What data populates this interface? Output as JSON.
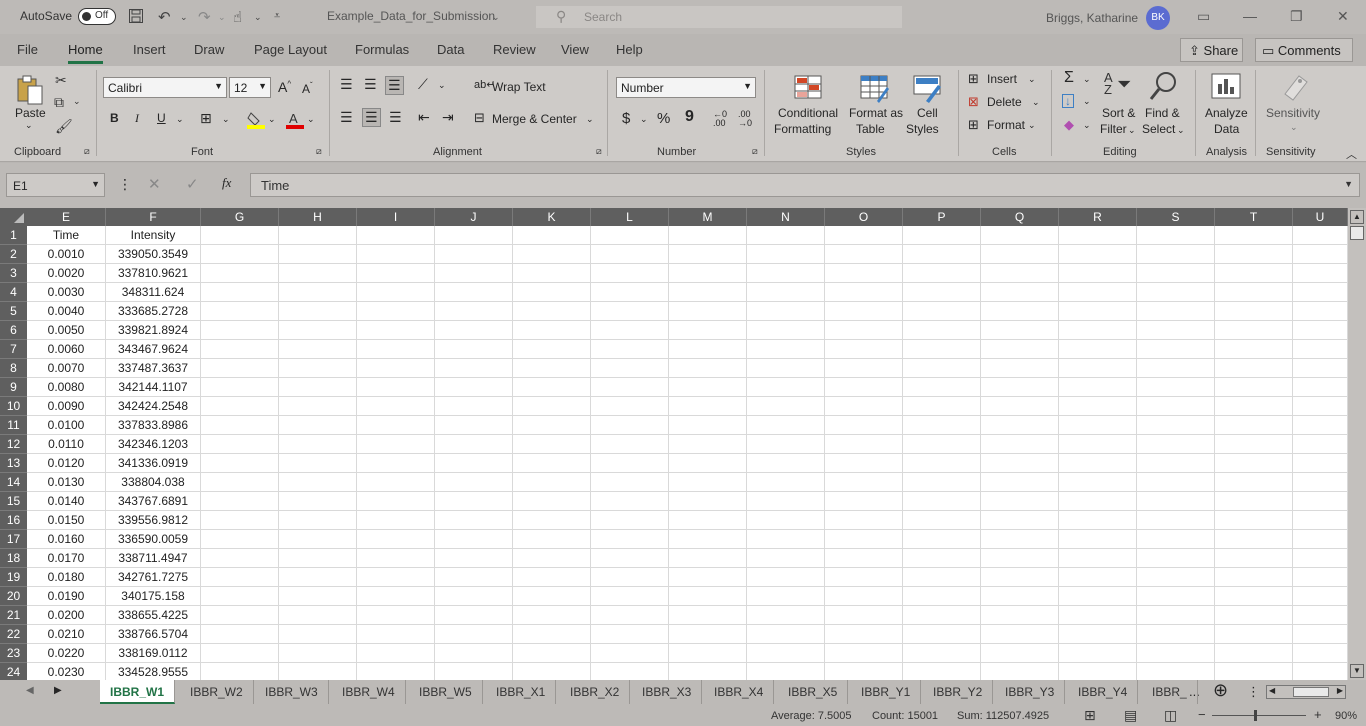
{
  "titlebar": {
    "autosave_label": "AutoSave",
    "autosave_state": "Off",
    "doc_title": "Example_Data_for_Submission",
    "search_placeholder": "Search",
    "user_name": "Briggs, Katharine",
    "user_initials": "BK"
  },
  "tabs": [
    "File",
    "Home",
    "Insert",
    "Draw",
    "Page Layout",
    "Formulas",
    "Data",
    "Review",
    "View",
    "Help"
  ],
  "active_tab": "Home",
  "share_label": "Share",
  "comments_label": "Comments",
  "ribbon": {
    "clipboard": {
      "label": "Clipboard",
      "paste": "Paste"
    },
    "font": {
      "label": "Font",
      "name": "Calibri",
      "size": "12"
    },
    "alignment": {
      "label": "Alignment",
      "wrap_text": "Wrap Text",
      "merge_center": "Merge & Center"
    },
    "number": {
      "label": "Number",
      "format": "Number",
      "currency": "$",
      "percent": "%",
      "comma": "9"
    },
    "styles": {
      "label": "Styles",
      "conditional_1": "Conditional",
      "conditional_2": "Formatting",
      "format_table_1": "Format as",
      "format_table_2": "Table",
      "cell_styles_1": "Cell",
      "cell_styles_2": "Styles"
    },
    "cells": {
      "label": "Cells",
      "insert": "Insert",
      "delete": "Delete",
      "format": "Format"
    },
    "editing": {
      "label": "Editing",
      "sort_1": "Sort &",
      "sort_2": "Filter",
      "find_1": "Find &",
      "find_2": "Select"
    },
    "analysis": {
      "label": "Analysis",
      "analyze_1": "Analyze",
      "analyze_2": "Data"
    },
    "sensitivity": {
      "label": "Sensitivity",
      "button": "Sensitivity"
    }
  },
  "formula_bar": {
    "name_box": "E1",
    "fx": "fx",
    "content": "Time"
  },
  "columns": [
    "E",
    "F",
    "G",
    "H",
    "I",
    "J",
    "K",
    "L",
    "M",
    "N",
    "O",
    "P",
    "Q",
    "R",
    "S",
    "T",
    "U"
  ],
  "rows": [
    {
      "n": "1",
      "e": "Time",
      "f": "Intensity"
    },
    {
      "n": "2",
      "e": "0.0010",
      "f": "339050.3549"
    },
    {
      "n": "3",
      "e": "0.0020",
      "f": "337810.9621"
    },
    {
      "n": "4",
      "e": "0.0030",
      "f": "348311.624"
    },
    {
      "n": "5",
      "e": "0.0040",
      "f": "333685.2728"
    },
    {
      "n": "6",
      "e": "0.0050",
      "f": "339821.8924"
    },
    {
      "n": "7",
      "e": "0.0060",
      "f": "343467.9624"
    },
    {
      "n": "8",
      "e": "0.0070",
      "f": "337487.3637"
    },
    {
      "n": "9",
      "e": "0.0080",
      "f": "342144.1107"
    },
    {
      "n": "10",
      "e": "0.0090",
      "f": "342424.2548"
    },
    {
      "n": "11",
      "e": "0.0100",
      "f": "337833.8986"
    },
    {
      "n": "12",
      "e": "0.0110",
      "f": "342346.1203"
    },
    {
      "n": "13",
      "e": "0.0120",
      "f": "341336.0919"
    },
    {
      "n": "14",
      "e": "0.0130",
      "f": "338804.038"
    },
    {
      "n": "15",
      "e": "0.0140",
      "f": "343767.6891"
    },
    {
      "n": "16",
      "e": "0.0150",
      "f": "339556.9812"
    },
    {
      "n": "17",
      "e": "0.0160",
      "f": "336590.0059"
    },
    {
      "n": "18",
      "e": "0.0170",
      "f": "338711.4947"
    },
    {
      "n": "19",
      "e": "0.0180",
      "f": "342761.7275"
    },
    {
      "n": "20",
      "e": "0.0190",
      "f": "340175.158"
    },
    {
      "n": "21",
      "e": "0.0200",
      "f": "338655.4225"
    },
    {
      "n": "22",
      "e": "0.0210",
      "f": "338766.5704"
    },
    {
      "n": "23",
      "e": "0.0220",
      "f": "338169.0112"
    },
    {
      "n": "24",
      "e": "0.0230",
      "f": "334528.9555"
    }
  ],
  "sheets": [
    "IBBR_W1",
    "IBBR_W2",
    "IBBR_W3",
    "IBBR_W4",
    "IBBR_W5",
    "IBBR_X1",
    "IBBR_X2",
    "IBBR_X3",
    "IBBR_X4",
    "IBBR_X5",
    "IBBR_Y1",
    "IBBR_Y2",
    "IBBR_Y3",
    "IBBR_Y4",
    "IBBR_"
  ],
  "active_sheet": "IBBR_W1",
  "ellipsis": "...",
  "status": {
    "average": "Average: 7.5005",
    "count": "Count: 15001",
    "sum": "Sum: 112507.4925",
    "zoom": "90%"
  },
  "colors": {
    "accent": "#217346",
    "avatar": "#5b6cd1",
    "font_color_bar": "#e00000",
    "highlight_bar": "#ffff00"
  }
}
